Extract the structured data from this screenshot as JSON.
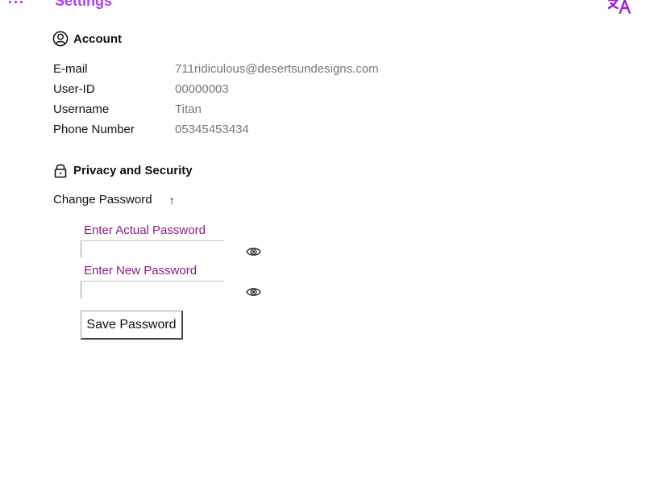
{
  "header": {
    "menu_glyph": "···",
    "title": "Settings",
    "translate_icon": "translate-icon"
  },
  "account": {
    "heading": "Account",
    "icon": "user-circle-icon",
    "rows": [
      {
        "label": "E-mail",
        "value": "711ridiculous@desertsundesigns.com"
      },
      {
        "label": "User-ID",
        "value": "00000003"
      },
      {
        "label": "Username",
        "value": "Titan"
      },
      {
        "label": "Phone Number",
        "value": "05345453434"
      }
    ]
  },
  "privacy": {
    "heading": "Privacy and Security",
    "icon": "lock-icon",
    "change_password_label": "Change Password",
    "toggle_glyph": "↑",
    "actual_password_label": "Enter Actual Password",
    "actual_password_value": "",
    "new_password_label": "Enter New Password",
    "new_password_value": "",
    "save_button_label": "Save Password"
  },
  "colors": {
    "accent": "#b23ee8",
    "field_label": "#8a1a8a",
    "value_text": "#777777"
  }
}
